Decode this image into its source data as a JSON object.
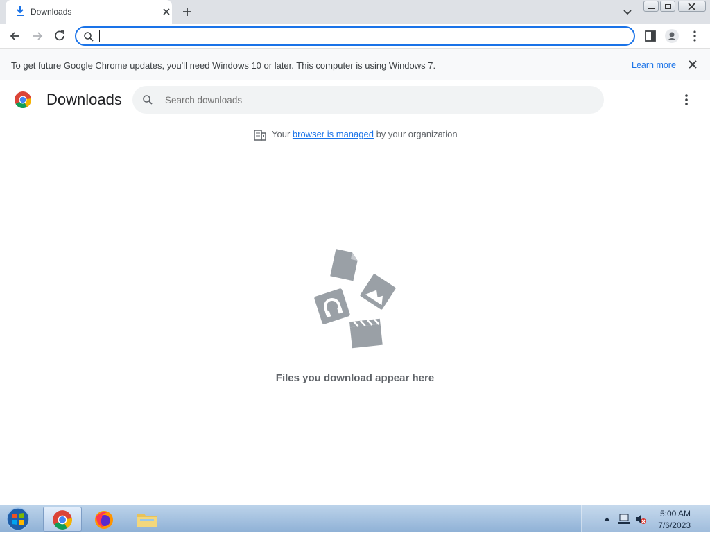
{
  "tab": {
    "title": "Downloads"
  },
  "omnibox": {
    "value": "",
    "placeholder": ""
  },
  "infobar": {
    "message": "To get future Google Chrome updates, you'll need Windows 10 or later. This computer is using Windows 7.",
    "learn_more": "Learn more"
  },
  "page": {
    "title": "Downloads",
    "search_placeholder": "Search downloads",
    "managed_prefix": "Your ",
    "managed_link": "browser is managed",
    "managed_suffix": " by your organization",
    "empty_message": "Files you download appear here"
  },
  "taskbar": {
    "time": "5:00 AM",
    "date": "7/6/2023"
  },
  "colors": {
    "accent": "#1a73e8",
    "tabstrip": "#dee1e6",
    "empty_art": "#9aa0a6"
  },
  "icons": [
    "download-icon",
    "close-icon",
    "plus-icon",
    "chevron-down-icon",
    "back-icon",
    "forward-icon",
    "reload-icon",
    "search-icon",
    "side-panel-icon",
    "profile-icon",
    "kebab-menu-icon",
    "chrome-logo-icon",
    "building-icon",
    "windows-start-icon",
    "firefox-icon",
    "file-explorer-icon"
  ]
}
